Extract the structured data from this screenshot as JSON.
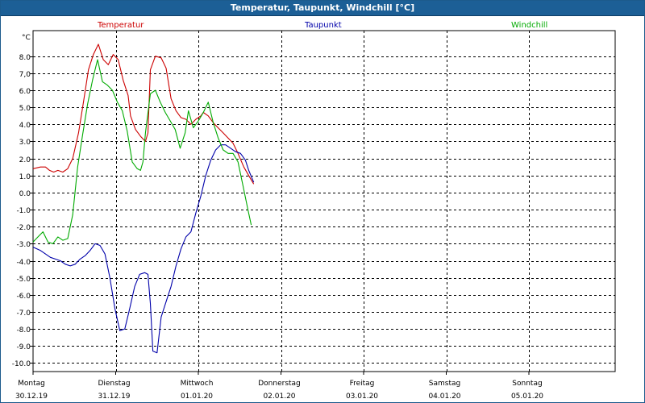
{
  "window": {
    "title": "Temperatur, Taupunkt, Windchill [°C]"
  },
  "colors": {
    "temperature": "#cc0000",
    "dewpoint": "#0000aa",
    "windchill": "#00aa00",
    "grid": "#000000",
    "titlebar": "#1c5f96"
  },
  "chart_data": {
    "type": "line",
    "title": "Temperatur, Taupunkt, Windchill [°C]",
    "ylabel": "°C",
    "ylim": [
      -10.5,
      9.5
    ],
    "yticks": [
      8.0,
      7.0,
      6.0,
      5.0,
      4.0,
      3.0,
      2.0,
      1.0,
      0.0,
      -1.0,
      -2.0,
      -3.0,
      -4.0,
      -5.0,
      -6.0,
      -7.0,
      -8.0,
      -9.0,
      -10.0
    ],
    "ytick_labels": [
      "8.0",
      "7,0",
      "6.0",
      "5.0",
      "4.0",
      "3.0",
      "2.0",
      "1.0",
      "0.0",
      "-1.0",
      "-2.0",
      "-3.0",
      "-4.0",
      "-5.0",
      "-6.0",
      "-7.0",
      "-8.0",
      "-9.0",
      "-10.0"
    ],
    "xlim_days": [
      0,
      7
    ],
    "x_categories": [
      {
        "day": "Montag",
        "date": "30.12.19"
      },
      {
        "day": "Dienstag",
        "date": "31.12.19"
      },
      {
        "day": "Mittwoch",
        "date": "01.01.20"
      },
      {
        "day": "Donnerstag",
        "date": "02.01.20"
      },
      {
        "day": "Freitag",
        "date": "03.01.20"
      },
      {
        "day": "Samstag",
        "date": "04.01.20"
      },
      {
        "day": "Sonntag",
        "date": "05.01.20"
      }
    ],
    "grid": true,
    "series": [
      {
        "name": "Temperatur",
        "color": "#cc0000",
        "points": [
          [
            0.0,
            1.4
          ],
          [
            0.09,
            1.5
          ],
          [
            0.15,
            1.5
          ],
          [
            0.2,
            1.3
          ],
          [
            0.25,
            1.2
          ],
          [
            0.3,
            1.3
          ],
          [
            0.36,
            1.2
          ],
          [
            0.42,
            1.4
          ],
          [
            0.48,
            2.0
          ],
          [
            0.55,
            3.5
          ],
          [
            0.61,
            5.3
          ],
          [
            0.67,
            7.2
          ],
          [
            0.73,
            8.1
          ],
          [
            0.79,
            8.7
          ],
          [
            0.85,
            7.8
          ],
          [
            0.91,
            7.5
          ],
          [
            0.97,
            8.1
          ],
          [
            1.03,
            7.8
          ],
          [
            1.09,
            6.6
          ],
          [
            1.15,
            5.7
          ],
          [
            1.18,
            4.5
          ],
          [
            1.24,
            3.7
          ],
          [
            1.3,
            3.3
          ],
          [
            1.36,
            3.0
          ],
          [
            1.39,
            3.5
          ],
          [
            1.42,
            7.2
          ],
          [
            1.48,
            8.0
          ],
          [
            1.55,
            7.9
          ],
          [
            1.61,
            7.3
          ],
          [
            1.67,
            5.5
          ],
          [
            1.73,
            4.8
          ],
          [
            1.79,
            4.4
          ],
          [
            1.85,
            4.3
          ],
          [
            1.91,
            4.0
          ],
          [
            1.97,
            4.3
          ],
          [
            2.03,
            4.5
          ],
          [
            2.06,
            4.7
          ],
          [
            2.12,
            4.5
          ],
          [
            2.18,
            4.1
          ],
          [
            2.24,
            3.8
          ],
          [
            2.3,
            3.5
          ],
          [
            2.36,
            3.2
          ],
          [
            2.42,
            2.9
          ],
          [
            2.48,
            2.3
          ],
          [
            2.55,
            1.5
          ],
          [
            2.61,
            1.0
          ],
          [
            2.67,
            0.5
          ]
        ]
      },
      {
        "name": "Taupunkt",
        "color": "#0000aa",
        "points": [
          [
            0.0,
            -3.2
          ],
          [
            0.09,
            -3.4
          ],
          [
            0.15,
            -3.6
          ],
          [
            0.21,
            -3.8
          ],
          [
            0.27,
            -3.9
          ],
          [
            0.33,
            -4.0
          ],
          [
            0.39,
            -4.2
          ],
          [
            0.45,
            -4.3
          ],
          [
            0.51,
            -4.2
          ],
          [
            0.57,
            -3.9
          ],
          [
            0.63,
            -3.7
          ],
          [
            0.69,
            -3.4
          ],
          [
            0.75,
            -3.0
          ],
          [
            0.81,
            -3.1
          ],
          [
            0.87,
            -3.6
          ],
          [
            0.93,
            -5.0
          ],
          [
            0.99,
            -6.8
          ],
          [
            1.05,
            -8.1
          ],
          [
            1.11,
            -8.0
          ],
          [
            1.17,
            -6.8
          ],
          [
            1.23,
            -5.5
          ],
          [
            1.29,
            -4.8
          ],
          [
            1.35,
            -4.7
          ],
          [
            1.39,
            -4.8
          ],
          [
            1.42,
            -6.5
          ],
          [
            1.45,
            -9.3
          ],
          [
            1.5,
            -9.4
          ],
          [
            1.55,
            -7.3
          ],
          [
            1.61,
            -6.4
          ],
          [
            1.67,
            -5.5
          ],
          [
            1.73,
            -4.3
          ],
          [
            1.79,
            -3.3
          ],
          [
            1.85,
            -2.6
          ],
          [
            1.91,
            -2.3
          ],
          [
            1.97,
            -1.2
          ],
          [
            2.03,
            -0.2
          ],
          [
            2.09,
            1.0
          ],
          [
            2.15,
            1.9
          ],
          [
            2.21,
            2.5
          ],
          [
            2.27,
            2.8
          ],
          [
            2.33,
            2.8
          ],
          [
            2.39,
            2.6
          ],
          [
            2.45,
            2.4
          ],
          [
            2.51,
            2.3
          ],
          [
            2.57,
            1.9
          ],
          [
            2.61,
            1.3
          ],
          [
            2.67,
            0.6
          ]
        ]
      },
      {
        "name": "Windchill",
        "color": "#00aa00",
        "points": [
          [
            0.0,
            -2.9
          ],
          [
            0.06,
            -2.6
          ],
          [
            0.12,
            -2.3
          ],
          [
            0.18,
            -2.9
          ],
          [
            0.24,
            -3.0
          ],
          [
            0.3,
            -2.6
          ],
          [
            0.36,
            -2.8
          ],
          [
            0.42,
            -2.7
          ],
          [
            0.48,
            -1.3
          ],
          [
            0.54,
            1.5
          ],
          [
            0.6,
            3.4
          ],
          [
            0.66,
            5.2
          ],
          [
            0.72,
            6.6
          ],
          [
            0.78,
            7.8
          ],
          [
            0.84,
            6.5
          ],
          [
            0.9,
            6.3
          ],
          [
            0.96,
            6.0
          ],
          [
            1.02,
            5.3
          ],
          [
            1.08,
            4.8
          ],
          [
            1.14,
            3.6
          ],
          [
            1.2,
            1.8
          ],
          [
            1.26,
            1.4
          ],
          [
            1.3,
            1.3
          ],
          [
            1.33,
            1.8
          ],
          [
            1.36,
            3.5
          ],
          [
            1.42,
            5.8
          ],
          [
            1.48,
            6.0
          ],
          [
            1.54,
            5.3
          ],
          [
            1.6,
            4.7
          ],
          [
            1.66,
            4.2
          ],
          [
            1.72,
            3.7
          ],
          [
            1.78,
            2.6
          ],
          [
            1.84,
            3.5
          ],
          [
            1.88,
            4.8
          ],
          [
            1.94,
            3.8
          ],
          [
            2.0,
            4.2
          ],
          [
            2.06,
            4.7
          ],
          [
            2.12,
            5.3
          ],
          [
            2.18,
            4.1
          ],
          [
            2.24,
            3.2
          ],
          [
            2.3,
            2.5
          ],
          [
            2.36,
            2.3
          ],
          [
            2.42,
            2.3
          ],
          [
            2.48,
            1.8
          ],
          [
            2.54,
            0.4
          ],
          [
            2.6,
            -1.0
          ],
          [
            2.64,
            -1.9
          ]
        ]
      }
    ]
  }
}
